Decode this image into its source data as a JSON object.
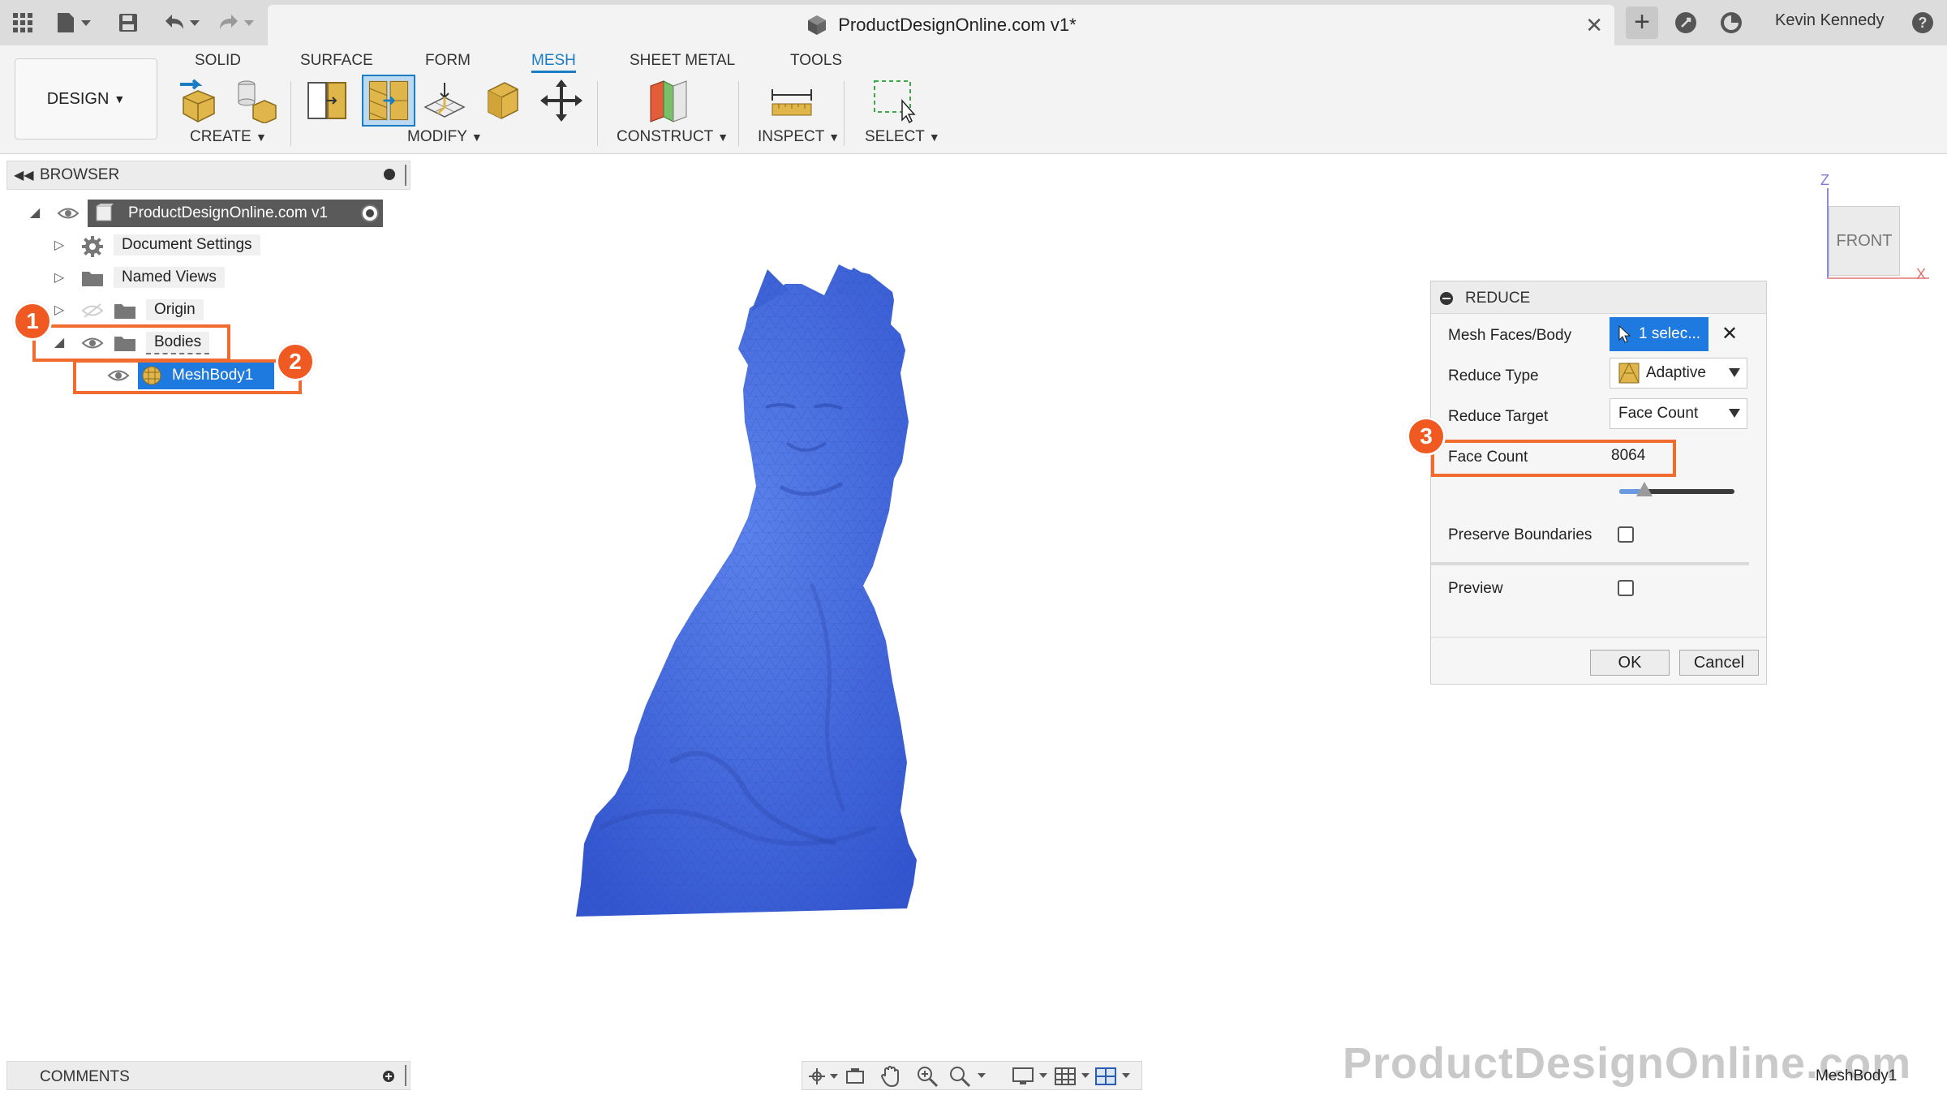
{
  "titlebar": {
    "document_title": "ProductDesignOnline.com v1*",
    "user_name": "Kevin Kennedy"
  },
  "ribbon": {
    "workspace_label": "DESIGN",
    "tabs": [
      {
        "label": "SOLID",
        "active": false
      },
      {
        "label": "SURFACE",
        "active": false
      },
      {
        "label": "FORM",
        "active": false
      },
      {
        "label": "MESH",
        "active": true
      },
      {
        "label": "SHEET METAL",
        "active": false
      },
      {
        "label": "TOOLS",
        "active": false
      }
    ],
    "groups": {
      "create": "CREATE",
      "modify": "MODIFY",
      "construct": "CONSTRUCT",
      "inspect": "INSPECT",
      "select": "SELECT"
    }
  },
  "browser": {
    "title": "BROWSER",
    "root": "ProductDesignOnline.com v1",
    "items": [
      {
        "label": "Document Settings"
      },
      {
        "label": "Named Views"
      },
      {
        "label": "Origin"
      },
      {
        "label": "Bodies"
      },
      {
        "label": "MeshBody1"
      }
    ]
  },
  "callouts": {
    "one": "1",
    "two": "2",
    "three": "3"
  },
  "reduce": {
    "title": "REDUCE",
    "mesh_faces_label": "Mesh Faces/Body",
    "mesh_faces_value": "1 selec...",
    "reduce_type_label": "Reduce Type",
    "reduce_type_value": "Adaptive",
    "reduce_target_label": "Reduce Target",
    "reduce_target_value": "Face Count",
    "face_count_label": "Face Count",
    "face_count_value": "8064",
    "slider_level": 0.22,
    "preserve_boundaries_label": "Preserve Boundaries",
    "preserve_boundaries_checked": false,
    "preview_label": "Preview",
    "preview_checked": false,
    "ok_label": "OK",
    "cancel_label": "Cancel"
  },
  "viewcube": {
    "face_label": "FRONT",
    "z_label": "Z",
    "x_label": "X"
  },
  "bottom": {
    "comments_title": "COMMENTS",
    "watermark": "ProductDesignOnline.com",
    "status_body": "MeshBody1"
  },
  "colors": {
    "accent": "#1a7dc4",
    "callout": "#f05a22",
    "mesh": "#3d63d6",
    "selection": "#1f7ae0"
  }
}
